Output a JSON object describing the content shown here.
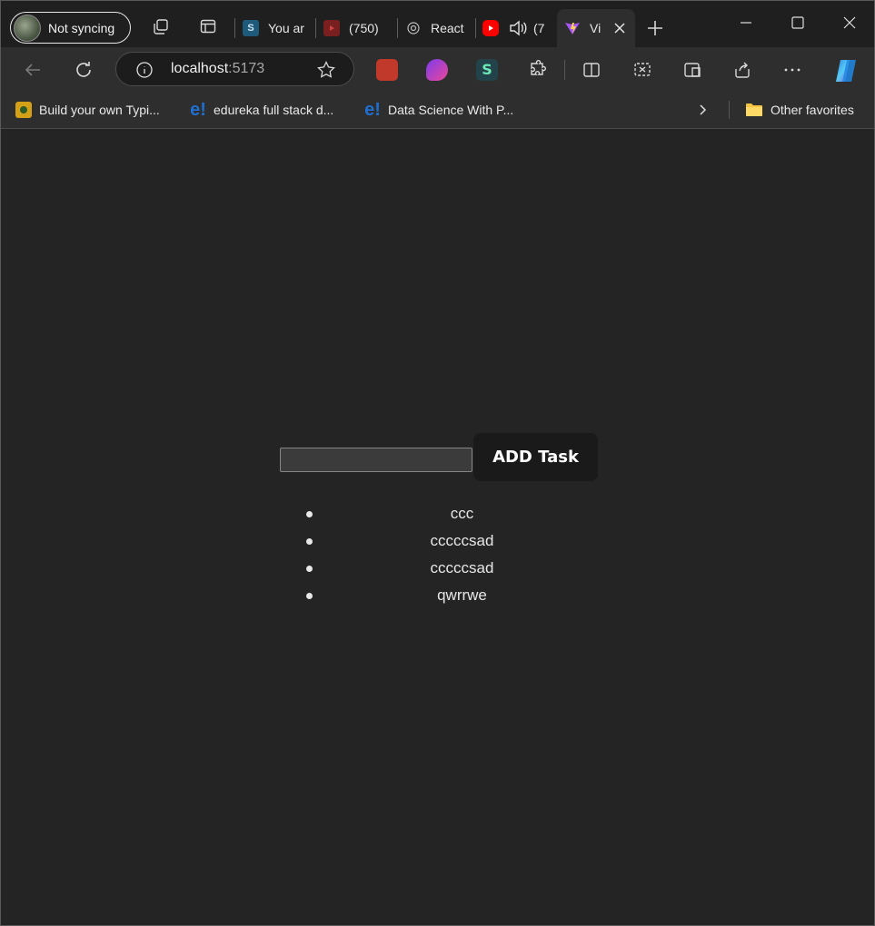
{
  "browser": {
    "profile_label": "Not syncing",
    "tabs": [
      {
        "label": "You ar",
        "favicon": "S",
        "color": "#1e5a7a"
      },
      {
        "label": "(750)",
        "favicon": "youtube-icon",
        "color": "#c0392b"
      },
      {
        "label": "React",
        "favicon": "openai-icon",
        "color": "#555555"
      },
      {
        "label": "(7",
        "favicon": "youtube-icon",
        "color": "#ff0000"
      },
      {
        "label": "Vi",
        "favicon": "vite-icon",
        "color": "#a855f7"
      }
    ],
    "address": {
      "host": "localhost",
      "port": ":5173"
    },
    "bookmarks": [
      {
        "label": "Build your own Typi..."
      },
      {
        "label": "edureka full stack d..."
      },
      {
        "label": "Data Science With P..."
      }
    ],
    "other_favorites": "Other favorites"
  },
  "app": {
    "input_value": "",
    "add_button_label": "ADD Task",
    "tasks": [
      "ccc",
      "cccccsad",
      "cccccsad",
      "qwrrwe"
    ]
  },
  "colors": {
    "page_bg": "#242424",
    "button_bg": "#1a1a1a",
    "chrome_bg": "#2e2e2e"
  }
}
